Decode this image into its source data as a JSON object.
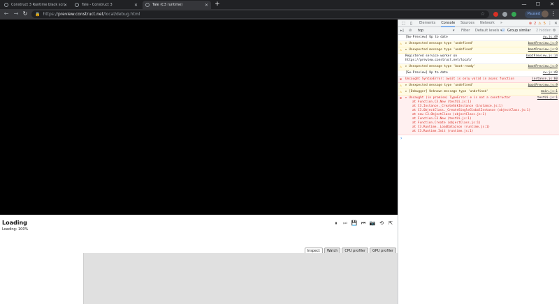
{
  "tabs": [
    {
      "title": "Construct 3 Runtime black scre...",
      "active": false
    },
    {
      "title": "Tale - Construct 3",
      "active": false
    },
    {
      "title": "Tale (C3 runtime)",
      "active": true
    }
  ],
  "window_controls": {
    "minimize": "—",
    "maximize": "☐",
    "close": "✕"
  },
  "toolbar": {
    "back": "←",
    "forward": "→",
    "reload": "↻",
    "lock": "🔒",
    "url_prefix": "https://",
    "url_host": "preview.construct.net",
    "url_path": "/local/debug.html",
    "star": "☆",
    "paused_label": "Paused",
    "menu": "⋮"
  },
  "debugger": {
    "title": "Loading",
    "progress": "Loading: 100%",
    "controls": [
      "⏸",
      "⏭",
      "💾",
      "⏮",
      "📷",
      "⟲",
      "⇱"
    ],
    "tabs": [
      "Inspect",
      "Watch",
      "CPU profiler",
      "GPU profiler"
    ],
    "active_tab": "Inspect"
  },
  "devtools": {
    "panels": [
      "Elements",
      "Console",
      "Sources",
      "Network",
      "»"
    ],
    "active_panel": "Console",
    "errors_count": "2",
    "warnings_count": "5",
    "context": "top",
    "filter_placeholder": "Filter",
    "levels": "Default levels ▾",
    "group_similar": "Group similar",
    "hidden": "2 hidden",
    "messages": [
      {
        "level": "info",
        "text": "[Sw-Preview] Up to date",
        "source": "sw.js:49"
      },
      {
        "level": "warn",
        "text": "▸ Unexpected message type 'undefined'",
        "source": "bootPreview.js:9"
      },
      {
        "level": "warn",
        "text": "▸ Unexpected message type 'undefined'",
        "source": "bootPreview.js:9"
      },
      {
        "level": "info",
        "text": "Registered service worker on https://preview.construct.net/local/",
        "source": "bootPreview.js:14"
      },
      {
        "level": "warn",
        "text": "▸ Unexpected message type 'boot-ready'",
        "source": "bootPreview.js:9"
      },
      {
        "level": "info",
        "text": "[Sw-Preview] Up to date",
        "source": "sw.js:49"
      },
      {
        "level": "error",
        "text": "Uncaught SyntaxError: await is only valid in async function",
        "source": "instance.js:60"
      },
      {
        "level": "warn",
        "text": "▸ Unexpected message type 'undefined'",
        "source": "bootPreview.js:9"
      },
      {
        "level": "warn",
        "text": "▸ [Debugger] Unknown message type 'undefined'",
        "source": "main.js:1"
      },
      {
        "level": "error",
        "text": "▸ Uncaught (in promise) TypeError: e is not a constructor",
        "source": "testUi.js:1",
        "stack": [
          "at Function.C3.New (testUi.js:1)",
          "at C3.Instance._CreateSdkInstance (instance.js:1)",
          "at C3.ObjectClass._CreateSingleGlobalInstance (objectClass.js:1)",
          "at new C3.ObjectClass (objectClass.js:1)",
          "at Function.C3.New (testUi.js:1)",
          "at Function.Create (objectClass.js:1)",
          "at C3.Runtime._LoadDataJson (runtime.js:1)",
          "at C3.Runtime.Init (runtime.js:1)"
        ]
      }
    ],
    "prompt": "›"
  },
  "colors": {
    "accent": "#1a73e8",
    "error": "#d93025",
    "warning": "#e3a100",
    "canvas": "#000000"
  }
}
